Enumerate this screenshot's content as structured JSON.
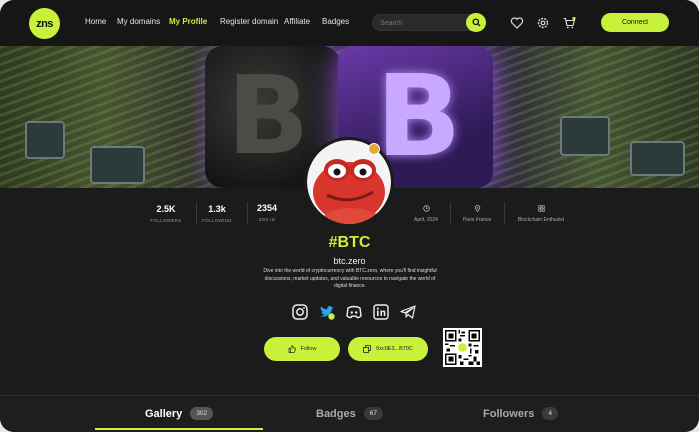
{
  "brand": {
    "logo_text": "zns",
    "accent": "#c8f13b"
  },
  "nav": {
    "links": [
      "Home",
      "My domains",
      "My Profile",
      "Register domain",
      "Affiliate",
      "Badges"
    ],
    "active": "My Profile",
    "search_placeholder": "Search",
    "connect_label": "Connect",
    "icons": [
      "heart-icon",
      "settings-icon",
      "cart-icon"
    ]
  },
  "profile": {
    "tag": "#BTC",
    "domain": "btc.zero",
    "bio": "Dive into the world of cryptocurrency with BTC.zero, where you'll find insightful discussions, market updates, and valuable resources to navigate the world of digital finance.",
    "stats": [
      {
        "value": "2.5K",
        "label": "FOLLOWERS"
      },
      {
        "value": "1.3k",
        "label": "FOLLOWING"
      },
      {
        "value": "2354",
        "label": "ZNS ID"
      }
    ],
    "info": [
      {
        "icon": "clock-icon",
        "text": "April, 2024"
      },
      {
        "icon": "location-icon",
        "text": "Paris France"
      },
      {
        "icon": "grid-icon",
        "text": "Blockchain Enthusist"
      }
    ],
    "socials": [
      "instagram-icon",
      "twitter-icon",
      "discord-icon",
      "linkedin-icon",
      "telegram-icon"
    ],
    "follow_label": "Follow",
    "address_label": "0xc0E3...B70C"
  },
  "tabs": [
    {
      "label": "Gallery",
      "count": "302",
      "active": true
    },
    {
      "label": "Badges",
      "count": "67",
      "active": false
    },
    {
      "label": "Followers",
      "count": "4",
      "active": false
    }
  ]
}
